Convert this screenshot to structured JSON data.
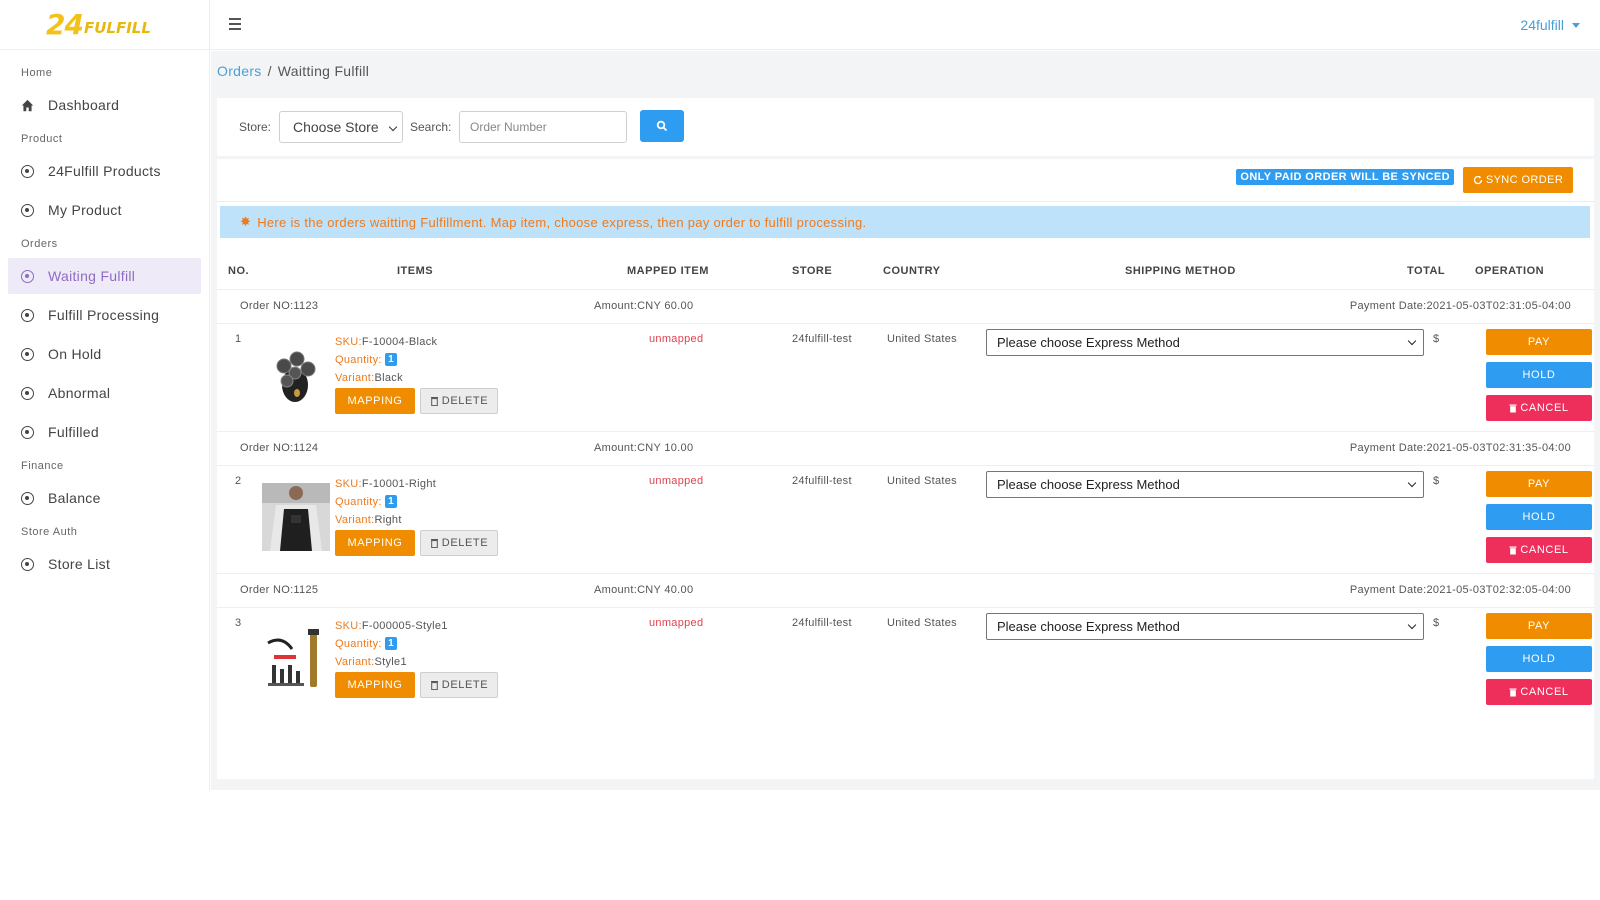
{
  "logo": {
    "brand_number": "24",
    "brand_word": "FULFILL"
  },
  "header": {
    "user": "24fulfill"
  },
  "sidebar": {
    "sections": [
      {
        "label": "Home",
        "items": [
          {
            "label": "Dashboard",
            "icon": "home-icon"
          }
        ]
      },
      {
        "label": "Product",
        "items": [
          {
            "label": "24Fulfill Products",
            "icon": "circle-dot-icon"
          },
          {
            "label": "My Product",
            "icon": "circle-dot-icon"
          }
        ]
      },
      {
        "label": "Orders",
        "items": [
          {
            "label": "Waiting Fulfill",
            "icon": "circle-dot-icon",
            "active": true
          },
          {
            "label": "Fulfill Processing",
            "icon": "circle-dot-icon"
          },
          {
            "label": "On Hold",
            "icon": "circle-dot-icon"
          },
          {
            "label": "Abnormal",
            "icon": "circle-dot-icon"
          },
          {
            "label": "Fulfilled",
            "icon": "circle-dot-icon"
          }
        ]
      },
      {
        "label": "Finance",
        "items": [
          {
            "label": "Balance",
            "icon": "circle-dot-icon"
          }
        ]
      },
      {
        "label": "Store Auth",
        "items": [
          {
            "label": "Store List",
            "icon": "circle-dot-icon"
          }
        ]
      }
    ]
  },
  "breadcrumb": {
    "parent": "Orders",
    "separator": "/",
    "current": "Waitting Fulfill"
  },
  "filter": {
    "store_label": "Store:",
    "store_value": "Choose Store",
    "search_label": "Search:",
    "search_placeholder": "Order Number"
  },
  "sync": {
    "note": "ONLY PAID ORDER WILL BE SYNCED",
    "button": "SYNC ORDER"
  },
  "info": "Here is the orders waitting Fulfillment. Map item, choose express, then pay order to fulfill processing.",
  "table": {
    "headers": {
      "no": "NO.",
      "items": "ITEMS",
      "mapped": "MAPPED ITEM",
      "store": "STORE",
      "country": "COUNTRY",
      "shipping": "SHIPPING METHOD",
      "total": "TOTAL",
      "operation": "OPERATION"
    }
  },
  "labels": {
    "sku": "SKU:",
    "quantity": "Quantity:",
    "variant": "Variant:",
    "mapping": "MAPPING",
    "delete": "DELETE",
    "pay": "PAY",
    "hold": "HOLD",
    "cancel": "CANCEL",
    "ship_placeholder": "Please choose Express Method"
  },
  "orders": [
    {
      "order_no": "Order NO:1123",
      "amount": "Amount:CNY 60.00",
      "payment_date": "Payment Date:2021-05-03T02:31:05-04:00",
      "no": "1",
      "sku": "F-10004-Black",
      "quantity": "1",
      "variant": "Black",
      "mapped": "unmapped",
      "store": "24fulfill-test",
      "country": "United States",
      "total": "$"
    },
    {
      "order_no": "Order NO:1124",
      "amount": "Amount:CNY 10.00",
      "payment_date": "Payment Date:2021-05-03T02:31:35-04:00",
      "no": "2",
      "sku": "F-10001-Right",
      "quantity": "1",
      "variant": "Right",
      "mapped": "unmapped",
      "store": "24fulfill-test",
      "country": "United States",
      "total": "$"
    },
    {
      "order_no": "Order NO:1125",
      "amount": "Amount:CNY 40.00",
      "payment_date": "Payment Date:2021-05-03T02:32:05-04:00",
      "no": "3",
      "sku": "F-000005-Style1",
      "quantity": "1",
      "variant": "Style1",
      "mapped": "unmapped",
      "store": "24fulfill-test",
      "country": "United States",
      "total": "$"
    }
  ],
  "colors": {
    "accent": "#2e9cf0",
    "orange": "#f08c00",
    "danger": "#ee2f5c",
    "active_nav": "#8e6cc2"
  }
}
